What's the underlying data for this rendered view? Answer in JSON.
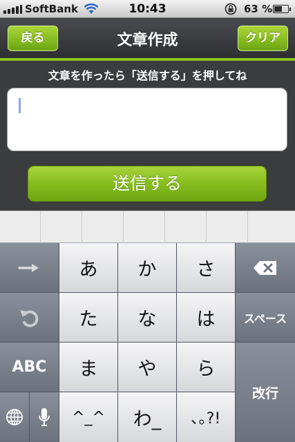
{
  "status_bar": {
    "carrier": "SoftBank",
    "time": "10:43",
    "battery_percent_text": "63 %",
    "battery_level": 0.63,
    "icons": [
      "signal-bars-icon",
      "wifi-icon",
      "rotation-lock-icon",
      "battery-icon"
    ]
  },
  "nav": {
    "back_label": "戻る",
    "title": "文章作成",
    "clear_label": "クリア"
  },
  "compose": {
    "instruction": "文章を作ったら「送信する」を押してね",
    "text_value": "",
    "send_label": "送信する"
  },
  "keyboard": {
    "arrow_key": "right-arrow-icon",
    "undo_key": "undo-icon",
    "delete_key": "delete-backspace-icon",
    "globe_key": "globe-icon",
    "mic_key": "microphone-icon",
    "abc_label": "ABC",
    "space_label": "スペース",
    "return_label": "改行",
    "kana": [
      "あ",
      "か",
      "さ",
      "た",
      "な",
      "は",
      "ま",
      "や",
      "ら",
      "^_^",
      "わ_",
      "､｡?!"
    ]
  },
  "colors": {
    "accent_green": "#8cc51c",
    "nav_dark": "#2e2f31"
  }
}
